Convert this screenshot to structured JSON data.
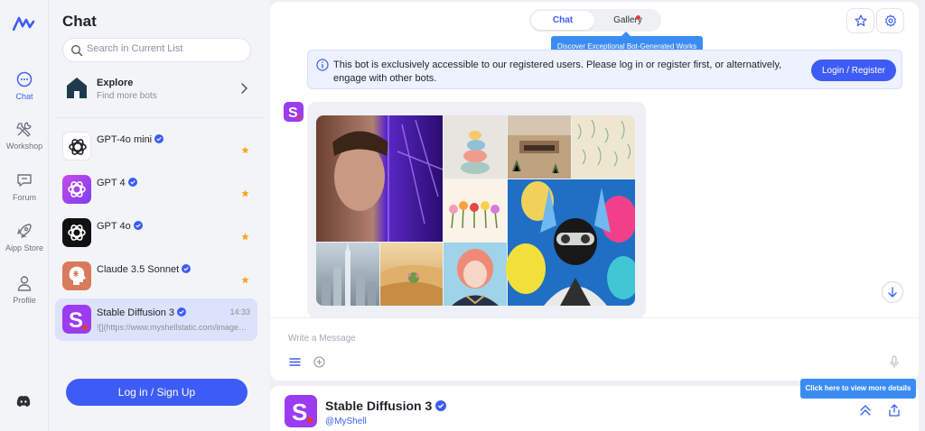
{
  "colors": {
    "accent": "#3d5cf5",
    "tooltip": "#3b8cf2",
    "selected_row": "#dde2fb",
    "badge_star": "#f5a623"
  },
  "rail": {
    "items": [
      {
        "label": "Chat",
        "icon": "chat-bubble-icon",
        "active": true
      },
      {
        "label": "Workshop",
        "icon": "tools-icon"
      },
      {
        "label": "Forum",
        "icon": "forum-icon"
      },
      {
        "label": "Aipp Store",
        "icon": "rocket-icon"
      },
      {
        "label": "Profile",
        "icon": "person-icon"
      }
    ],
    "bottom_icon": "discord-icon"
  },
  "panel": {
    "title": "Chat",
    "search_placeholder": "Search in Current List",
    "explore": {
      "title": "Explore",
      "subtitle": "Find more bots"
    },
    "bots": [
      {
        "name": "GPT-4o mini",
        "verified": true,
        "starred": true
      },
      {
        "name": "GPT 4",
        "verified": true,
        "starred": true
      },
      {
        "name": "GPT 4o",
        "verified": true,
        "starred": true
      },
      {
        "name": "Claude 3.5 Sonnet",
        "verified": true,
        "starred": true
      },
      {
        "name": "Stable Diffusion 3",
        "verified": true,
        "time": "14:33",
        "preview": "![](https://www.myshellstatic.com/image/chat/embed_obj/202407220/2/...",
        "selected": true
      }
    ],
    "login_label": "Log in / Sign Up"
  },
  "main": {
    "tabs": [
      {
        "label": "Chat",
        "active": true
      },
      {
        "label": "Gallery",
        "has_dot": true
      }
    ],
    "tooltip": "Discover Exceptional Bot-Generated Works",
    "notice": {
      "text": "This bot is exclusively accessible to our registered users. Please log in or register first, or alternatively, engage with other bots.",
      "button": "Login / Register"
    },
    "compose_placeholder": "Write a Message"
  },
  "bottom": {
    "name": "Stable Diffusion 3",
    "handle": "@MyShell",
    "details_tip": "Click here to view more details"
  }
}
